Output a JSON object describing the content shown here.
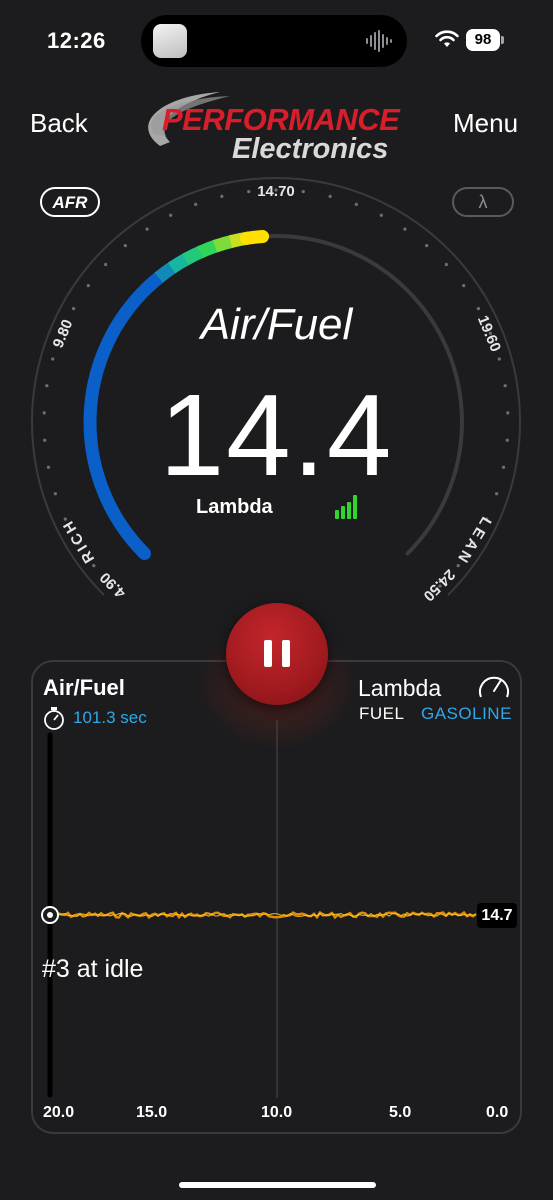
{
  "status_bar": {
    "time": "12:26",
    "battery": "98"
  },
  "nav": {
    "back": "Back",
    "menu": "Menu"
  },
  "logo": {
    "line1": "PERFORMANCE",
    "line2": "Electronics"
  },
  "gauge": {
    "mode_afr": "AFR",
    "mode_lambda": "λ",
    "title": "Air/Fuel",
    "value": "14.4",
    "unit_label": "Lambda",
    "rich_label": "RICH",
    "lean_label": "LEAN",
    "scale_labels": [
      "4.90",
      "9.80",
      "14.70",
      "19.60",
      "24.50"
    ],
    "min": 4.9,
    "max": 24.5,
    "reading": 14.4
  },
  "controls": {
    "pause_icon": "pause-icon"
  },
  "chart_panel": {
    "title": "Air/Fuel",
    "timer": "101.3 sec",
    "lambda_label": "Lambda",
    "fuel_label": "FUEL",
    "fuel_value": "GASOLINE",
    "note": "#3 at idle",
    "current_value": "14.7",
    "x_ticks": [
      "20.0",
      "15.0",
      "10.0",
      "5.0",
      "0.0"
    ]
  },
  "colors": {
    "accent_blue": "#2ea9e8",
    "pause_red": "#b01e23",
    "gauge_blue": "#0a5fc8",
    "trace_orange": "#f0a020"
  },
  "chart_data": {
    "type": "line",
    "xlabel": "",
    "ylabel": "",
    "x_ticks": [
      20.0,
      15.0,
      10.0,
      5.0,
      0.0
    ],
    "xlim": [
      20.0,
      0.0
    ],
    "series": [
      {
        "values_approx_constant": 14.7
      }
    ]
  }
}
